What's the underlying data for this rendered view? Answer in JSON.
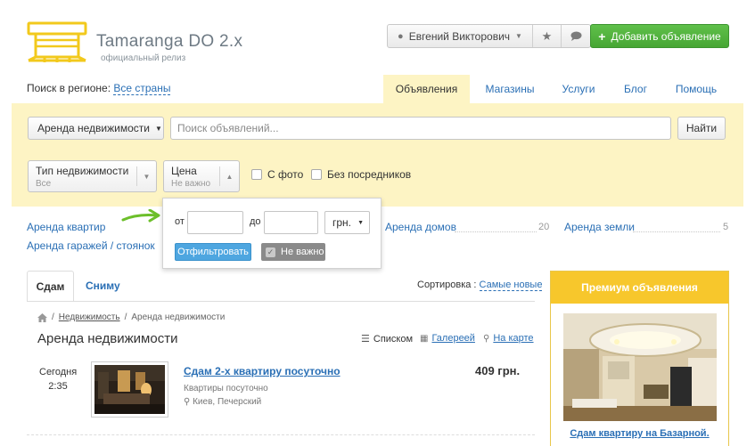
{
  "header": {
    "brand_name": "Tamaranga DO 2.x",
    "brand_sub": "официальный релиз",
    "user_name": "Евгений Викторович",
    "add_button": "Добавить объявление"
  },
  "region": {
    "label": "Поиск в регионе:",
    "value": "Все страны"
  },
  "nav": [
    {
      "label": "Объявления",
      "active": true
    },
    {
      "label": "Магазины"
    },
    {
      "label": "Услуги"
    },
    {
      "label": "Блог"
    },
    {
      "label": "Помощь"
    }
  ],
  "search": {
    "category": "Аренда недвижимости",
    "placeholder": "Поиск объявлений...",
    "button": "Найти"
  },
  "filters": {
    "type": {
      "title": "Тип недвижимости",
      "value": "Все"
    },
    "price": {
      "title": "Цена",
      "value": "Не важно"
    },
    "with_photo": "С фото",
    "no_agents": "Без посредников"
  },
  "price_popup": {
    "from": "от",
    "to": "до",
    "currency": "грн.",
    "apply": "Отфильтровать",
    "not_important": "Не важно"
  },
  "categories": [
    {
      "label": "Аренда квартир"
    },
    {
      "label": "Аренда гаражей / стоянок"
    },
    {
      "label": "Аренда домов",
      "count": "20"
    },
    {
      "label": "Аренда земли",
      "count": "5"
    }
  ],
  "tabs": {
    "sdam": "Сдам",
    "snimu": "Сниму"
  },
  "sort": {
    "label": "Сортировка :",
    "value": "Самые новые"
  },
  "breadcrumbs": {
    "link": "Недвижимость",
    "current": "Аренда недвижимости"
  },
  "page_title": "Аренда недвижимости",
  "views": {
    "list": "Списком",
    "gallery": "Галереей",
    "map": "На карте"
  },
  "listing": {
    "date": "Сегодня",
    "time": "2:35",
    "title": "Сдам 2-х квартиру посуточно",
    "category": "Квартиры посуточно",
    "location": "Киев, Печерский",
    "price": "409 грн."
  },
  "premium": {
    "title": "Премиум объявления",
    "item_title": "Сдам квартиру на Базарной."
  },
  "colors": {
    "accent_blue": "#2a6fb5",
    "panel_yellow": "#fdf4c4",
    "add_green": "#4cae39",
    "premium_yellow": "#f7c72c",
    "arrow_green": "#6cbf2a"
  }
}
